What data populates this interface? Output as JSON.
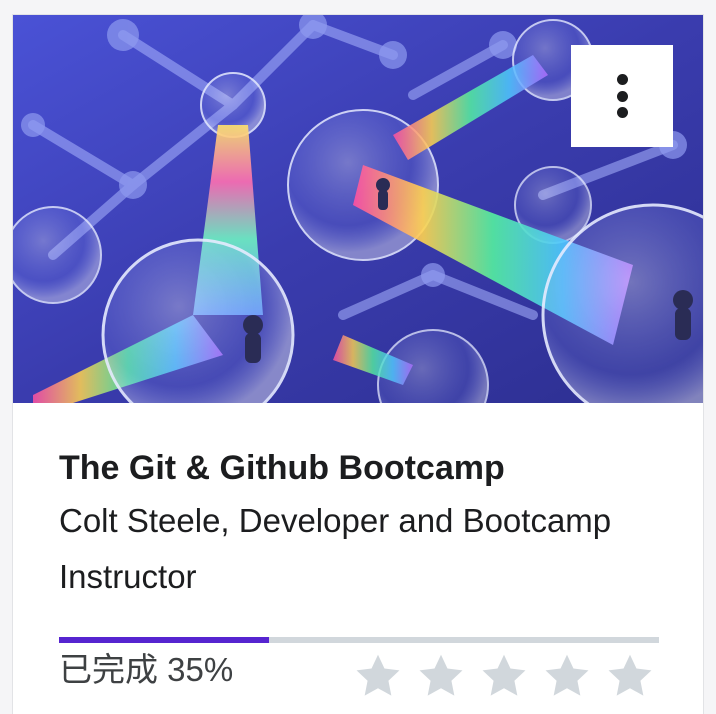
{
  "course": {
    "title": "The Git & Github Bootcamp",
    "instructor": "Colt Steele, Developer and Bootcamp Instructor",
    "thumbnail_icon": "course-thumbnail-image"
  },
  "menu": {
    "icon": "more-vertical-icon"
  },
  "progress": {
    "label": "已完成 35%",
    "percent": 35
  },
  "rating": {
    "max": 5,
    "value": 0,
    "icon": "star-icon"
  },
  "colors": {
    "accent": "#5624d0",
    "track": "#d1d7dc",
    "star_empty": "#d1d7dc",
    "text": "#1c1d1f",
    "thumb_bg": "#3d3fb8"
  }
}
